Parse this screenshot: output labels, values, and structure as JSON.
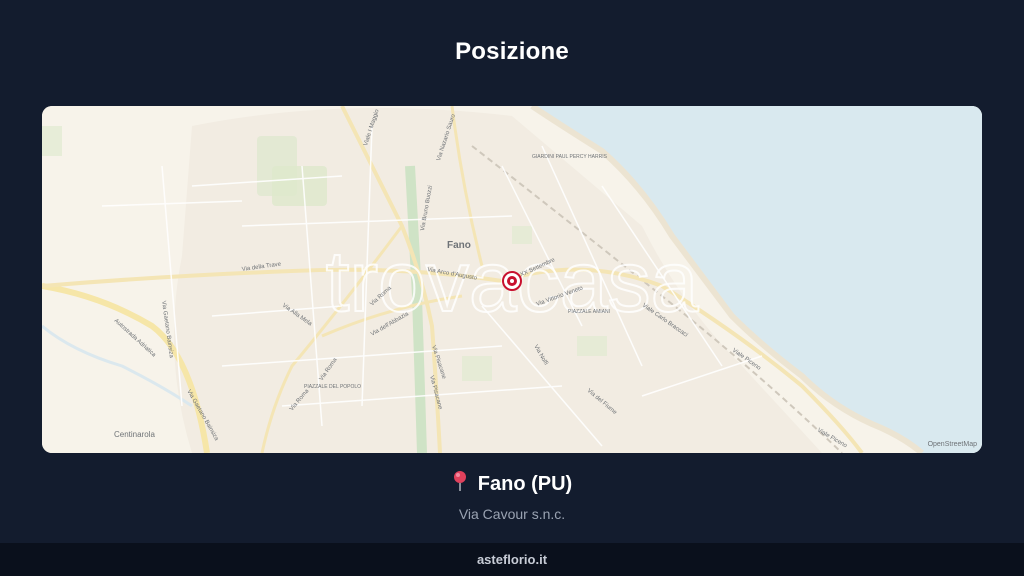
{
  "header": {
    "title": "Posizione"
  },
  "map": {
    "watermark": "trovacasa",
    "attribution": "OpenStreetMap",
    "city_label": "Fano",
    "district_label": "Centinarola",
    "street_labels": {
      "viale_i_maggio": "Viale I Maggio",
      "via_nazario_sauro": "Via Nazario Sauro",
      "via_della_trave": "Via della Trave",
      "via_alcide_bruno_buozzi": "Via Bruno Buozzi",
      "via_roma_north": "Via Roma",
      "via_dell_abbazia": "Via dell'Abbazia",
      "via_roma_south": "Via Roma",
      "via_roma_west": "Via Roma",
      "via_pisacane": "Via Pisacane",
      "via_gaetano_bainsiza": "Via Gaetano Bainsiza",
      "autostrada": "Autostrada Adriatica",
      "via_gaetano_carducci": "Via Gaetano Bainsiza",
      "via_xx_settembre": "Via XX Settembre",
      "via_vittorio_veneto": "Via Vittorio Veneto",
      "viale_carlo_braccaci": "Viale Carlo Braccaci",
      "viale_piceno": "Viale Piceno",
      "via_del_fiume": "Via del Fiume",
      "via_nolfi": "Via Nolfi",
      "via_pisacane_2": "Via Pisacane",
      "viale_piceno_2": "Viale Piceno",
      "via_arco_d_augusto": "Via Arco d'Augusto",
      "via_alla_mela": "Via Alla Mela"
    },
    "poi_labels": {
      "piazzale": "PIAZZALE DEL POPOLO",
      "piazzale_amiani": "PIAZZALE AMIANI",
      "giardini": "GIARDINI PAUL PERCY HARRIS"
    },
    "marker_icon": "location-marker-icon"
  },
  "location": {
    "icon": "pin-icon",
    "name": "Fano (PU)",
    "address": "Via Cavour s.n.c."
  },
  "footer": {
    "brand": "asteflorio.it"
  },
  "colors": {
    "background": "#131c2e",
    "footer": "#0a101c",
    "sea": "#d9e9ef",
    "land": "#f7f3ea",
    "marker": "#c8102e"
  }
}
